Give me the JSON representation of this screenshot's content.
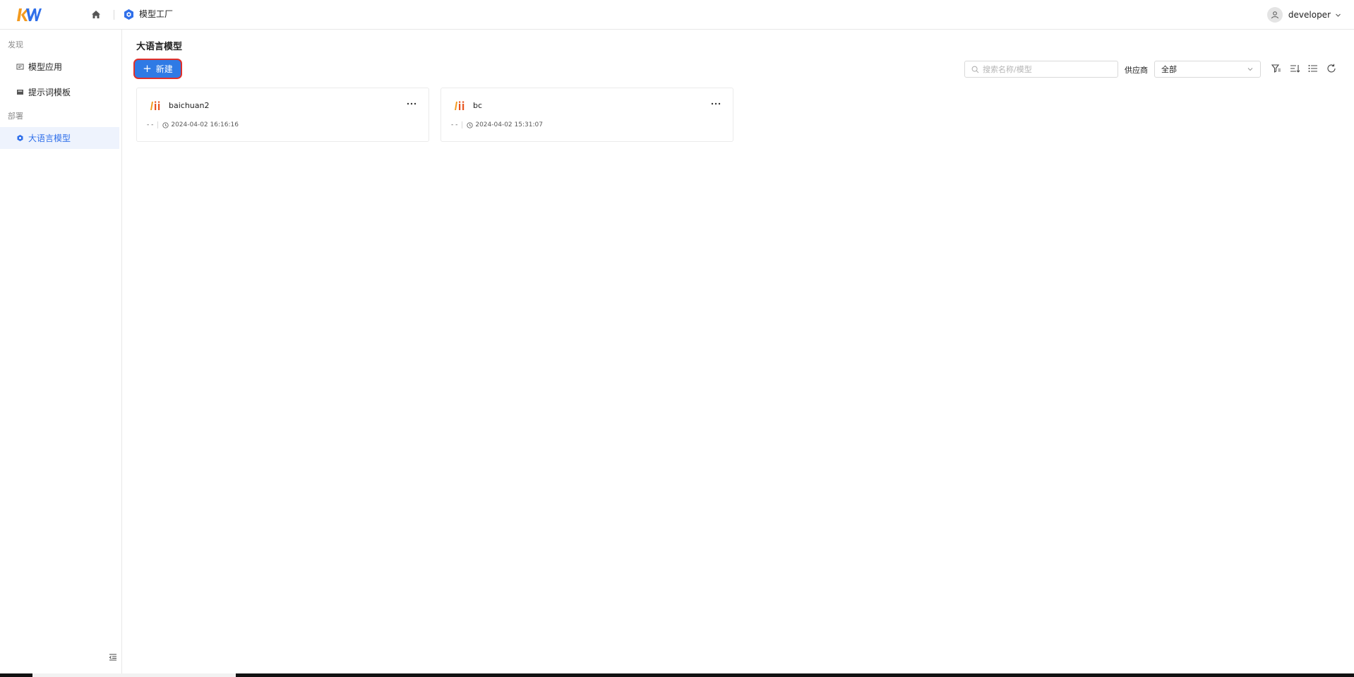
{
  "header": {
    "app_title": "模型工厂",
    "user_name": "developer"
  },
  "sidebar": {
    "groups": [
      {
        "label": "发现",
        "items": [
          {
            "label": "模型应用"
          },
          {
            "label": "提示词模板"
          }
        ]
      },
      {
        "label": "部署",
        "items": [
          {
            "label": "大语言模型"
          }
        ]
      }
    ],
    "active_item": "大语言模型"
  },
  "main": {
    "page_title": "大语言模型",
    "new_button_label": "新建",
    "search_placeholder": "搜索名称/模型",
    "vendor_label": "供应商",
    "vendor_selected": "全部"
  },
  "cards": [
    {
      "name": "baichuan2",
      "desc": "- -",
      "time": "2024-04-02 16:16:16"
    },
    {
      "name": "bc",
      "desc": "- -",
      "time": "2024-04-02 15:31:07"
    }
  ],
  "colors": {
    "primary": "#2f7ae5",
    "highlight_border": "#e0302a",
    "active_bg": "#eef3fd",
    "logo_orange": "#f39a1e",
    "logo_blue": "#2f6fea"
  },
  "icons": {
    "logo": "kw-logo",
    "home": "home-icon",
    "app": "model-factory-icon",
    "user": "user-icon",
    "search": "search-icon",
    "filter": "filter-icon",
    "sort": "sort-icon",
    "list": "list-view-icon",
    "refresh": "refresh-icon",
    "more": "more-icon",
    "clock": "clock-icon",
    "collapse": "collapse-sidebar-icon"
  }
}
